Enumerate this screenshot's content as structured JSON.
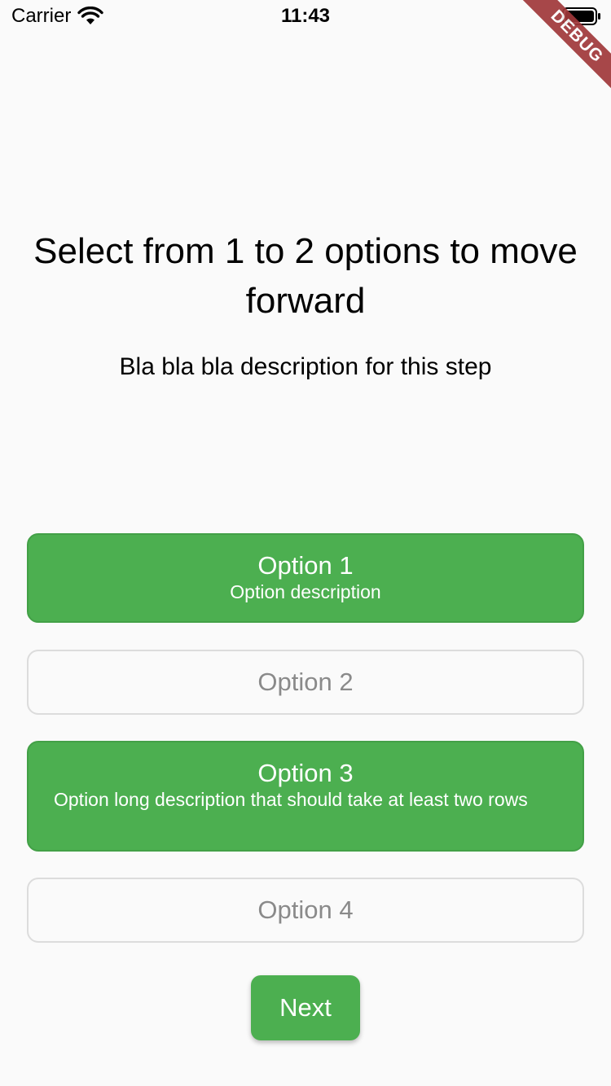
{
  "status_bar": {
    "carrier": "Carrier",
    "time": "11:43",
    "wifi_icon": "wifi-icon",
    "battery_icon": "battery-icon"
  },
  "debug_banner": "DEBUG",
  "header": {
    "title": "Select from 1 to 2 options to move forward",
    "description": "Bla bla bla description for this step"
  },
  "options": [
    {
      "label": "Option 1",
      "description": "Option description",
      "selected": true
    },
    {
      "label": "Option 2",
      "description": "",
      "selected": false
    },
    {
      "label": "Option 3",
      "description": "Option long description that should take at least two rows",
      "selected": true
    },
    {
      "label": "Option 4",
      "description": "",
      "selected": false
    }
  ],
  "next_button": {
    "label": "Next"
  },
  "colors": {
    "selected_bg": "#4caf50",
    "unselected_border": "#dcdcdc",
    "unselected_text": "#8a8a8a",
    "debug_ribbon": "#a0383a"
  }
}
